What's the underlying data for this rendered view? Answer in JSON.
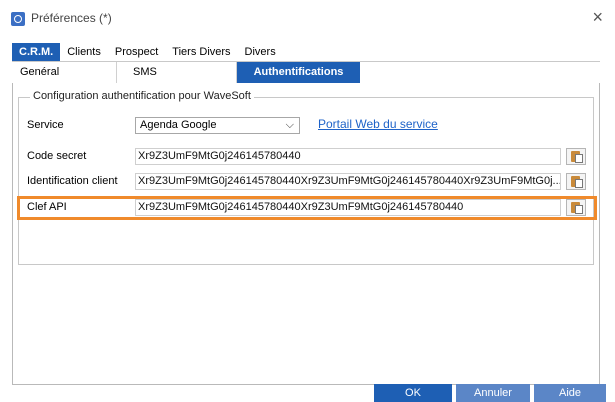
{
  "window": {
    "title": "Préférences (*)",
    "close_symbol": "×"
  },
  "tabs_main": [
    "C.R.M.",
    "Clients",
    "Prospect",
    "Tiers Divers",
    "Divers"
  ],
  "tabs_sub": [
    "Genéral",
    "SMS",
    "Authentifications"
  ],
  "group": {
    "legend": "Configuration authentification pour WaveSoft"
  },
  "service": {
    "label": "Service",
    "selected": "Agenda Google",
    "chevron": "⌵",
    "portal_link": "Portail Web du service"
  },
  "code_secret": {
    "label": "Code secret",
    "value": "Xr9Z3UmF9MtG0j246145780440"
  },
  "identification_client": {
    "label": "Identification client",
    "value": "Xr9Z3UmF9MtG0j246145780440Xr9Z3UmF9MtG0j246145780440Xr9Z3UmF9MtG0j..."
  },
  "clef_api": {
    "label": "Clef API",
    "value": "Xr9Z3UmF9MtG0j246145780440Xr9Z3UmF9MtG0j246145780440"
  },
  "buttons": {
    "ok": "OK",
    "cancel": "Annuler",
    "help": "Aide"
  },
  "colors": {
    "accent": "#1e5fb4",
    "highlight": "#f08a2b",
    "link": "#1f63c8"
  }
}
